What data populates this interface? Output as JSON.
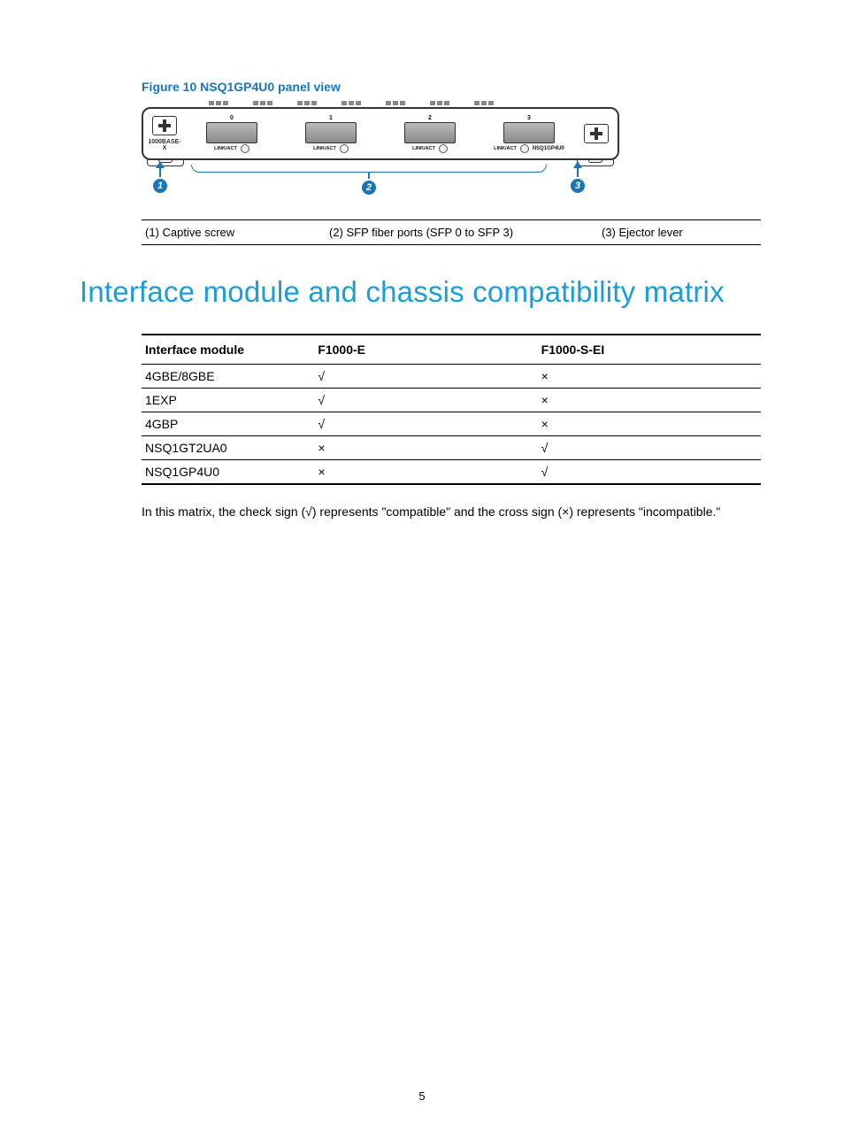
{
  "figure": {
    "caption": "Figure 10 NSQ1GP4U0 panel view",
    "base_label": "1000BASE-X",
    "product_label": "NSQ1GP4U0",
    "link_act": "LINK/ACT",
    "port_numbers": [
      "0",
      "1",
      "2",
      "3"
    ],
    "callouts": {
      "c1": "1",
      "c2": "2",
      "c3": "3"
    }
  },
  "legend": {
    "l1": "(1) Captive screw",
    "l2": "(2) SFP fiber ports (SFP 0 to SFP 3)",
    "l3": "(3) Ejector lever"
  },
  "section_title": "Interface module and chassis compatibility matrix",
  "matrix": {
    "headers": {
      "module": "Interface module",
      "f1000e": "F1000-E",
      "f1000sei": "F1000-S-EI"
    },
    "rows": [
      {
        "module": "4GBE/8GBE",
        "f1000e": "√",
        "f1000sei": "×"
      },
      {
        "module": "1EXP",
        "f1000e": "√",
        "f1000sei": "×"
      },
      {
        "module": "4GBP",
        "f1000e": "√",
        "f1000sei": "×"
      },
      {
        "module": "NSQ1GT2UA0",
        "f1000e": "×",
        "f1000sei": "√"
      },
      {
        "module": "NSQ1GP4U0",
        "f1000e": "×",
        "f1000sei": "√"
      }
    ]
  },
  "body_text": "In this matrix, the check sign (√) represents \"compatible\" and the cross sign (×) represents \"incompatible.\"",
  "page_number": "5"
}
